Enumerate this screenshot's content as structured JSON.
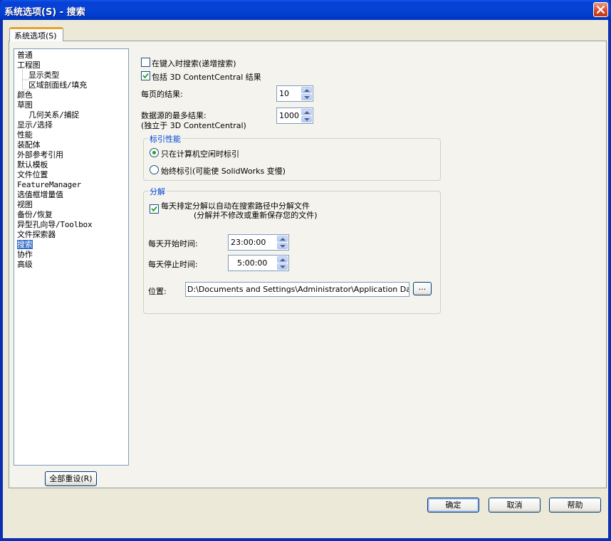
{
  "window": {
    "title": "系统选项(S) - 搜索"
  },
  "tab": {
    "label": "系统选项(S)"
  },
  "tree": {
    "items": [
      {
        "label": "普通",
        "level": 1
      },
      {
        "label": "工程图",
        "level": 1
      },
      {
        "label": "显示类型",
        "level": 2
      },
      {
        "label": "区域剖面线/填充",
        "level": 2
      },
      {
        "label": "颜色",
        "level": 1
      },
      {
        "label": "草图",
        "level": 1
      },
      {
        "label": "几何关系/捕捉",
        "level": 2
      },
      {
        "label": "显示/选择",
        "level": 1
      },
      {
        "label": "性能",
        "level": 1
      },
      {
        "label": "装配体",
        "level": 1
      },
      {
        "label": "外部参考引用",
        "level": 1
      },
      {
        "label": "默认模板",
        "level": 1
      },
      {
        "label": "文件位置",
        "level": 1
      },
      {
        "label": "FeatureManager",
        "level": 1
      },
      {
        "label": "选值框增量值",
        "level": 1
      },
      {
        "label": "视图",
        "level": 1
      },
      {
        "label": "备份/恢复",
        "level": 1
      },
      {
        "label": "异型孔向导/Toolbox",
        "level": 1
      },
      {
        "label": "文件探索器",
        "level": 1
      },
      {
        "label": "搜索",
        "level": 1,
        "selected": true
      },
      {
        "label": "协作",
        "level": 1
      },
      {
        "label": "高级",
        "level": 1
      }
    ],
    "reset_label": "全部重设(R)"
  },
  "search": {
    "search_while_typing": {
      "label": "在键入时搜索(递增搜索)",
      "checked": false
    },
    "include_3dcc": {
      "label": "包括 3D ContentCentral 结果",
      "checked": true
    },
    "results_per_page": {
      "label": "每页的结果:",
      "value": "10"
    },
    "max_results": {
      "label": "数据源的最多结果:",
      "sublabel": "(独立于 3D ContentCentral)",
      "value": "1000"
    }
  },
  "indexing": {
    "title": "标引性能",
    "option_idle": {
      "label": "只在计算机空闲时标引",
      "selected": true
    },
    "option_always": {
      "label": "始终标引(可能使 SolidWorks 变慢)",
      "selected": false
    }
  },
  "dissection": {
    "title": "分解",
    "schedule": {
      "label": "每天排定分解以自动在搜索路径中分解文件",
      "sublabel": "(分解并不修改或重新保存您的文件)",
      "checked": true
    },
    "start_time": {
      "label": "每天开始时间:",
      "value": "23:00:00"
    },
    "stop_time": {
      "label": "每天停止时间:",
      "value": "5:00:00"
    },
    "location": {
      "label": "位置:",
      "value": "D:\\Documents and Settings\\Administrator\\Application Data\\Solid'",
      "browse_label": "..."
    }
  },
  "buttons": {
    "ok": "确定",
    "cancel": "取消",
    "help": "帮助"
  },
  "colors": {
    "titlebar": "#0543d4",
    "selection": "#316ac5",
    "group_title": "#0046d5",
    "check_green": "#21a121",
    "close_red": "#d5492a"
  }
}
